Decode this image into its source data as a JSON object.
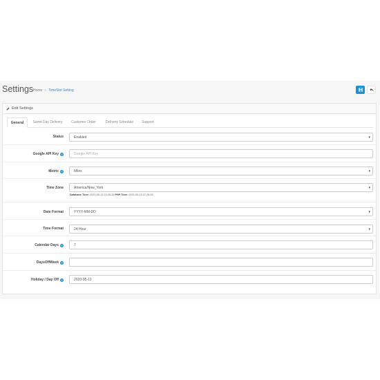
{
  "header": {
    "title": "Settings",
    "breadcrumb": {
      "home": "Home",
      "separator": "»",
      "current": "TimeSlot Setting"
    }
  },
  "toolbar": {
    "save_icon": "floppy-disk-icon",
    "back_icon": "reply-arrow-icon"
  },
  "panel": {
    "heading": "Edit Settings",
    "heading_icon": "pencil-icon"
  },
  "tabs": [
    {
      "label": "General",
      "active": true
    },
    {
      "label": "Same Day Delivery",
      "active": false
    },
    {
      "label": "Customer Order",
      "active": false
    },
    {
      "label": "Delivery Schedule",
      "active": false
    },
    {
      "label": "Support",
      "active": false
    }
  ],
  "form": {
    "status": {
      "label": "Status",
      "value": "Enabled"
    },
    "google_api_key": {
      "label": "Google API Key",
      "placeholder": "Google API Key",
      "value": ""
    },
    "metric": {
      "label": "Metric",
      "value": "Miles"
    },
    "time_zone": {
      "label": "Time Zone",
      "value": "America/New_York",
      "db_time_label": "Database Time:",
      "db_time_value": "2020-05-13 15:26:25",
      "php_time_label": "PHP Time:",
      "php_time_value": "2020-05-13 07:26:25"
    },
    "date_format": {
      "label": "Date Format",
      "value": "YYYY-MM-DD"
    },
    "time_format": {
      "label": "Time Format",
      "value": "24 Hour"
    },
    "calendar_days": {
      "label": "Calendar Days",
      "value": "7"
    },
    "days_off_week": {
      "label": "DaysOffWeek",
      "value": ""
    },
    "holiday_day_off": {
      "label": "Holiday / Day Off",
      "value": "2020-05-13"
    }
  },
  "colors": {
    "accent": "#1e91cf",
    "background": "#f6f6f6"
  }
}
